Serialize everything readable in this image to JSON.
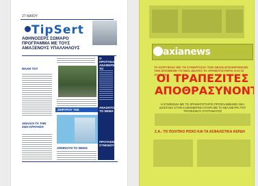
{
  "page1": {
    "date": "27 ΜΑΪΟΥ",
    "logo": "TipSert",
    "headline": "ΑΘΗΝΟΣΕΡΣ ΣΩΜΑΡΟ ΠΡΟΓΡΑΜΜΑ ΜΕ ΤΟΥΣ ΑΜΑΞΕΝΟΥΣ ΥΠΑΛΛΗΛΟΥΣ",
    "col_head_1": "ΜΑΧΗ ΤΟΥ",
    "col_head_2": "ΑΜΑΧΟΙ ΤΑ ΤΗΝ ΖΩΗ ΚΡΑΤΗΣΗ",
    "side_head_1": "Ο ΠΡΟΫΠΟΛΟΓΙΣΜΟΣ ΑΝΑΦΕΡΕΙ ΤΟ",
    "side_head_2": "ΑΝΑΖΗΤΟΥΝ ΤΟ ΘΕΜΑ",
    "side_head_3": "ΠΡΟΤΑΣΕΙΣ ΣΥΝΟΔΟΥ",
    "blue_panel": "ΖΕΦΥΡΟΥ ΤΗΣ ΟΙΚΟΝΟΜΙΑΣ",
    "bottom_head": "ΑΦΗΝΟΥΝ ΤΟ ΘΕΜΑ"
  },
  "page2": {
    "masthead": "axianews",
    "kicker": "ΤΑ ΚΟΡΥΦΑΙΑ ΜΕ ΤΗ ΣΥΝΕΡΓΑΣΙΑ ΤΩΝ ΝΕΩΝ ΕΠΙΧΕΙΡΗΣΕΩΝ ΤΗΝ ΕΠΟΜΕΝΗ ΤΟ ΝΕΟ ΔΕΛΤΙΟ ΤΑ ΧΡΗΜΑΤΙΣΤΗΡΙΑ ΚΑΙ ΟΙ ΑΓΟΡΕΣ",
    "main_headline": "ΟΙ ΤΡΑΠΕΖΙΤΕΣ ΑΠΟΘΡΑΣΥΝΟΝΤΑΙ!",
    "subhead": "Η ΣΥΜΦΩΝΙΑ ΜΕ ΤΟ ΧΡΗΜΑΤΙΣΤΗΡΙΟ ΠΡΟΣΛΑΜΒΑΝΕΙ ΝΕΑ ΔΙΑΣΤΑΣΗ ΣΤΗΝ ΚΑΘΗΜΕΡΙΝΗ ΑΓΟΡΑ ΜΕ ΤΑ ΝΕΑ ΜΕΤΡΑ ΤΟΥ ΤΡΑΠΕΖΙΚΟΥ ΣΥΣΤΗΜΑΤΟΣ",
    "second_headline": "Σ.Α.: ΤΟ ΠΟΛΙΤΙΚΟ ΡΙΣΚΟ ΚΑΙ ΤΑ ΑΣΦΑΛΙΣΤΙΚΑ ΚΕΡΔΗ"
  }
}
